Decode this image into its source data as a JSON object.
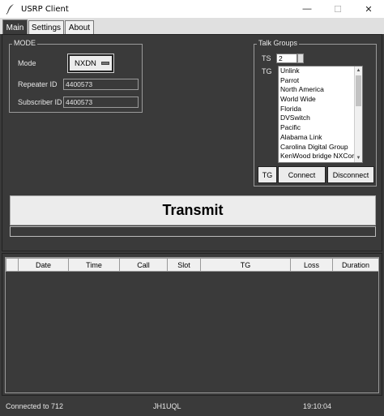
{
  "window": {
    "title": "USRP Client",
    "minimize": "—",
    "maximize": "☐",
    "close": "✕"
  },
  "tabs": [
    {
      "label": "Main",
      "active": true
    },
    {
      "label": "Settings",
      "active": false
    },
    {
      "label": "About",
      "active": false
    }
  ],
  "mode_group": {
    "title": "MODE",
    "mode_label": "Mode",
    "mode_value": "NXDN",
    "repeater_label": "Repeater ID",
    "repeater_value": "4400573",
    "subscriber_label": "Subscriber ID",
    "subscriber_value": "4400573"
  },
  "talk_groups": {
    "title": "Talk Groups",
    "ts_label": "TS",
    "ts_value": "2",
    "tg_label": "TG",
    "items": [
      "Unlink",
      "Parrot",
      "North America",
      "World Wide",
      "Florida",
      "DVSwitch",
      "Pacific",
      "Alabama Link",
      "Carolina Digital Group",
      "KenWood bridge NXCore"
    ],
    "tg_button": "TG",
    "connect_button": "Connect",
    "disconnect_button": "Disconnect"
  },
  "transmit": {
    "label": "Transmit",
    "level": 0
  },
  "log_table": {
    "columns": [
      "",
      "Date",
      "Time",
      "Call",
      "Slot",
      "TG",
      "Loss",
      "Duration"
    ],
    "rows": []
  },
  "status_bar": {
    "connection": "Connected to 712",
    "callsign": "JH1UQL",
    "time": "19:10:04"
  },
  "colors": {
    "background": "#3a3a3a",
    "button_face": "#ececec",
    "text_light": "#eaeaea"
  }
}
